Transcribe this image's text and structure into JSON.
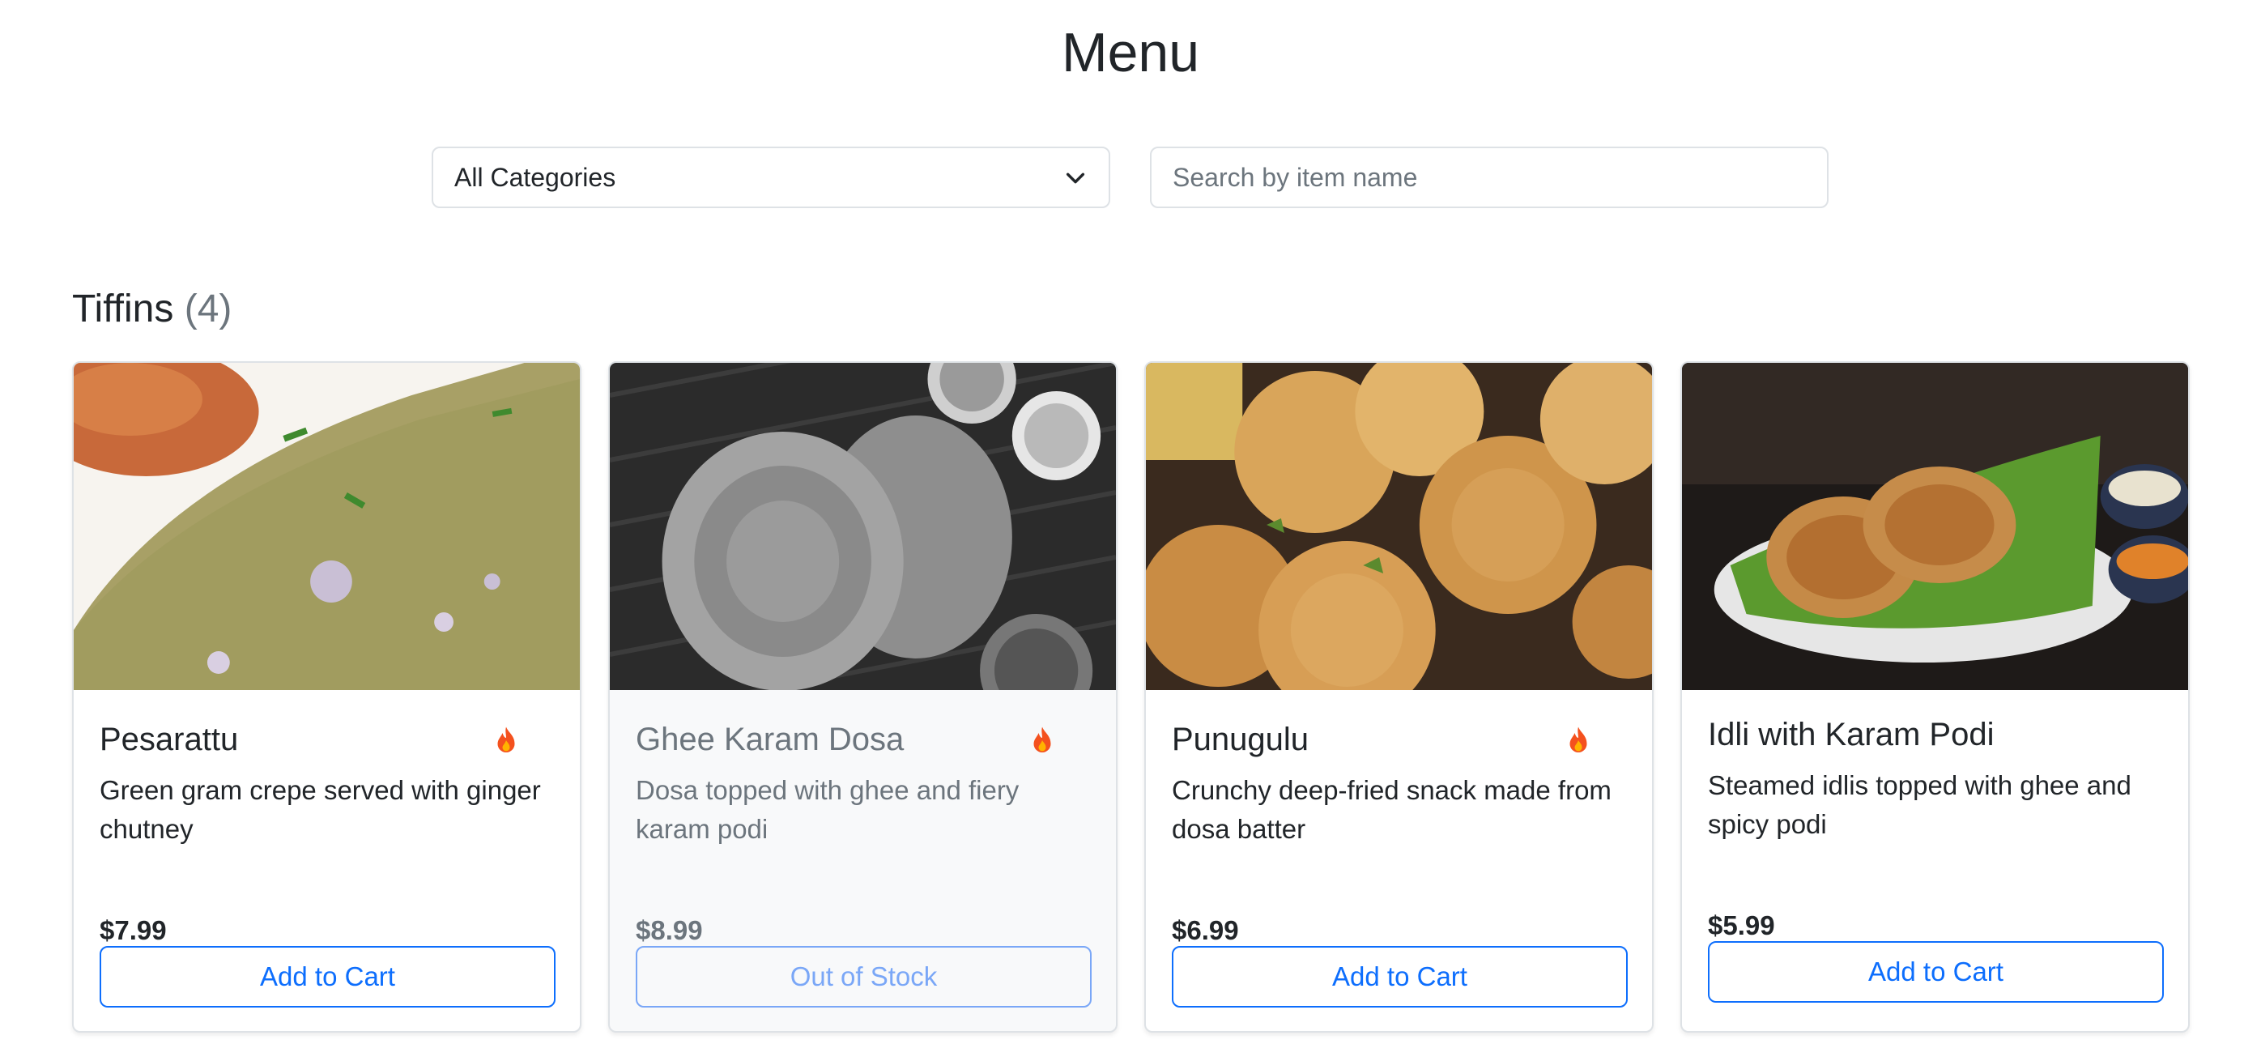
{
  "page": {
    "title": "Menu"
  },
  "filters": {
    "category_selected": "All Categories",
    "search_placeholder": "Search by item name",
    "search_value": ""
  },
  "section": {
    "name": "Tiffins",
    "count": "(4)"
  },
  "items": [
    {
      "name": "Pesarattu",
      "description": "Green gram crepe served with ginger chutney",
      "price": "$7.99",
      "button": "Add to Cart",
      "spicy": true,
      "available": true
    },
    {
      "name": "Ghee Karam Dosa",
      "description": "Dosa topped with ghee and fiery karam podi",
      "price": "$8.99",
      "button": "Out of Stock",
      "spicy": true,
      "available": false
    },
    {
      "name": "Punugulu",
      "description": "Crunchy deep-fried snack made from dosa batter",
      "price": "$6.99",
      "button": "Add to Cart",
      "spicy": true,
      "available": true
    },
    {
      "name": "Idli with Karam Podi",
      "description": "Steamed idlis topped with ghee and spicy podi",
      "price": "$5.99",
      "button": "Add to Cart",
      "spicy": false,
      "available": true
    }
  ],
  "colors": {
    "accent": "#0d6efd",
    "muted": "#6c757d",
    "border": "#dee2e6"
  },
  "icons": {
    "spicy": "fire-icon",
    "dropdown": "chevron-down-icon"
  }
}
